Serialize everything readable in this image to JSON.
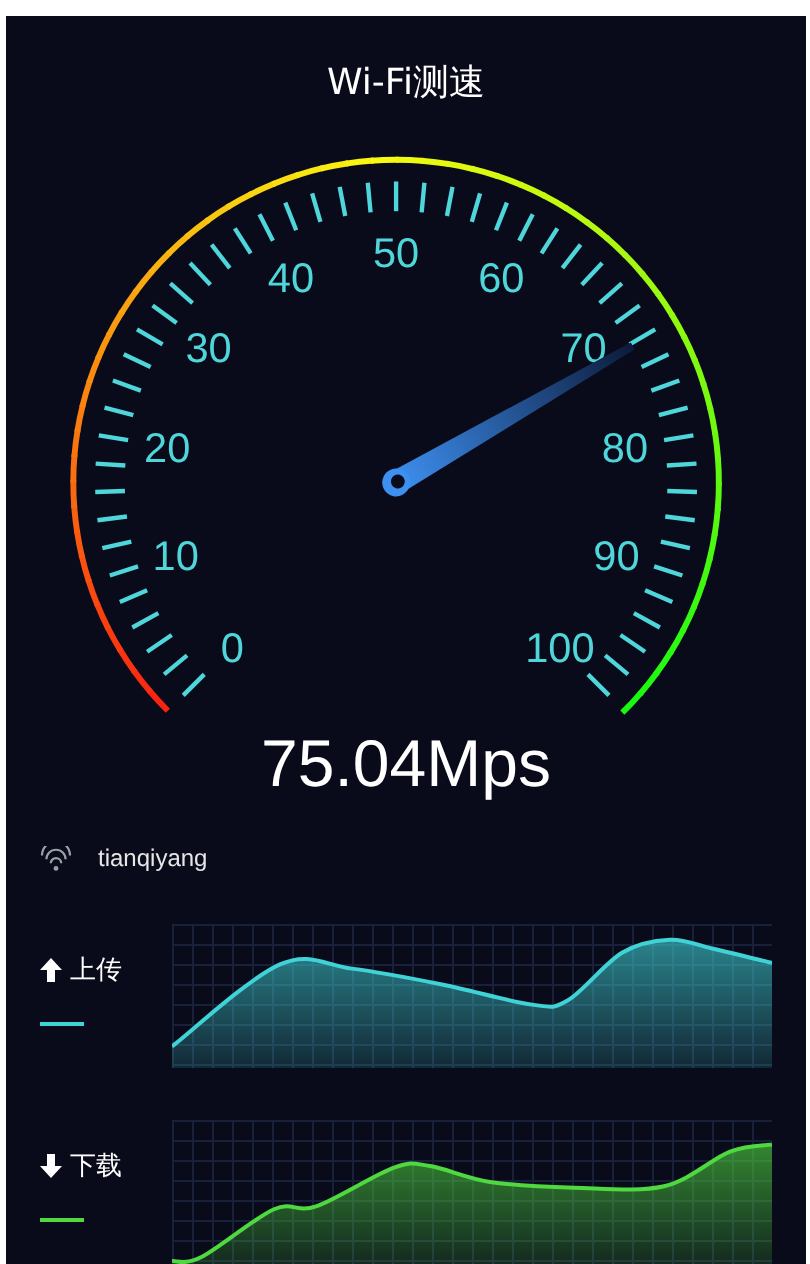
{
  "title": "Wi-Fi测速",
  "gauge": {
    "labels": [
      "0",
      "10",
      "20",
      "30",
      "40",
      "50",
      "60",
      "70",
      "80",
      "90",
      "100"
    ]
  },
  "speed": "75.04Mps",
  "network": {
    "name": "tianqiyang"
  },
  "charts": [
    {
      "kind": "upload",
      "label": "上传",
      "color": "#3fd3d6"
    },
    {
      "kind": "download",
      "label": "下载",
      "color": "#4fd83f"
    }
  ]
}
